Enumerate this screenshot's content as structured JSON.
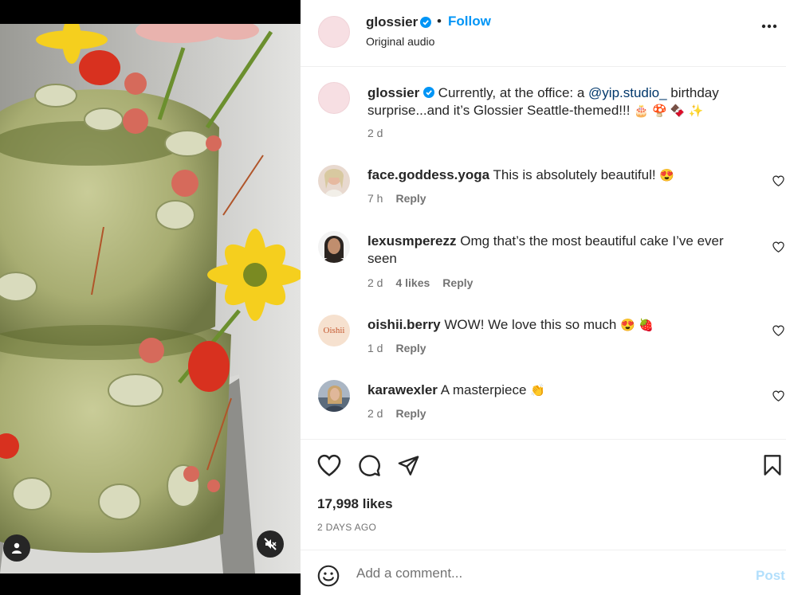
{
  "header": {
    "username": "glossier",
    "follow_label": "Follow",
    "audio_label": "Original audio"
  },
  "caption": {
    "username": "glossier",
    "text_before": "Currently, at the office: a ",
    "mention": "@yip.studio_",
    "text_after": " birthday surprise...and it’s Glossier Seattle-themed!!!",
    "emojis": "🎂 🍄 🍫 ✨",
    "time": "2 d"
  },
  "comments": [
    {
      "username": "face.goddess.yoga",
      "text": "This is absolutely beautiful!",
      "emoji": "😍",
      "time": "7 h",
      "likes": "",
      "reply_label": "Reply"
    },
    {
      "username": "lexusmperezz",
      "text": "Omg that’s the most beautiful cake I’ve ever seen",
      "emoji": "",
      "time": "2 d",
      "likes": "4 likes",
      "reply_label": "Reply"
    },
    {
      "username": "oishii.berry",
      "text": "WOW! We love this so much",
      "emoji": "😍 🍓",
      "time": "1 d",
      "likes": "",
      "reply_label": "Reply",
      "avatar_text": "Oishii"
    },
    {
      "username": "karawexler",
      "text": "A masterpiece",
      "emoji": "👏",
      "time": "2 d",
      "likes": "",
      "reply_label": "Reply"
    }
  ],
  "actions": {
    "likes": "17,998 likes",
    "date": "2 DAYS AGO"
  },
  "add_comment": {
    "placeholder": "Add a comment...",
    "post_label": "Post"
  },
  "colors": {
    "accent": "#0095f6",
    "post_disabled": "#b2dffc",
    "verified": "#0095f6",
    "muted_text": "#737373"
  },
  "icons": [
    "verified-badge-icon",
    "more-options-icon",
    "heart-icon",
    "comment-icon",
    "share-icon",
    "save-icon",
    "emoji-icon",
    "user-tag-icon",
    "mute-icon"
  ]
}
